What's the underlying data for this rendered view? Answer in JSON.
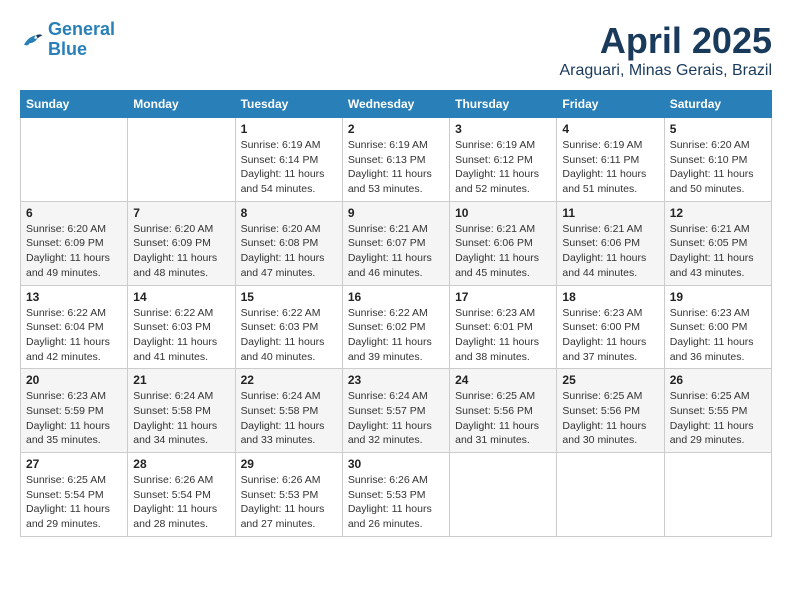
{
  "logo": {
    "line1": "General",
    "line2": "Blue"
  },
  "title": "April 2025",
  "location": "Araguari, Minas Gerais, Brazil",
  "headers": [
    "Sunday",
    "Monday",
    "Tuesday",
    "Wednesday",
    "Thursday",
    "Friday",
    "Saturday"
  ],
  "weeks": [
    [
      {
        "day": "",
        "info": ""
      },
      {
        "day": "",
        "info": ""
      },
      {
        "day": "1",
        "info": "Sunrise: 6:19 AM\nSunset: 6:14 PM\nDaylight: 11 hours and 54 minutes."
      },
      {
        "day": "2",
        "info": "Sunrise: 6:19 AM\nSunset: 6:13 PM\nDaylight: 11 hours and 53 minutes."
      },
      {
        "day": "3",
        "info": "Sunrise: 6:19 AM\nSunset: 6:12 PM\nDaylight: 11 hours and 52 minutes."
      },
      {
        "day": "4",
        "info": "Sunrise: 6:19 AM\nSunset: 6:11 PM\nDaylight: 11 hours and 51 minutes."
      },
      {
        "day": "5",
        "info": "Sunrise: 6:20 AM\nSunset: 6:10 PM\nDaylight: 11 hours and 50 minutes."
      }
    ],
    [
      {
        "day": "6",
        "info": "Sunrise: 6:20 AM\nSunset: 6:09 PM\nDaylight: 11 hours and 49 minutes."
      },
      {
        "day": "7",
        "info": "Sunrise: 6:20 AM\nSunset: 6:09 PM\nDaylight: 11 hours and 48 minutes."
      },
      {
        "day": "8",
        "info": "Sunrise: 6:20 AM\nSunset: 6:08 PM\nDaylight: 11 hours and 47 minutes."
      },
      {
        "day": "9",
        "info": "Sunrise: 6:21 AM\nSunset: 6:07 PM\nDaylight: 11 hours and 46 minutes."
      },
      {
        "day": "10",
        "info": "Sunrise: 6:21 AM\nSunset: 6:06 PM\nDaylight: 11 hours and 45 minutes."
      },
      {
        "day": "11",
        "info": "Sunrise: 6:21 AM\nSunset: 6:06 PM\nDaylight: 11 hours and 44 minutes."
      },
      {
        "day": "12",
        "info": "Sunrise: 6:21 AM\nSunset: 6:05 PM\nDaylight: 11 hours and 43 minutes."
      }
    ],
    [
      {
        "day": "13",
        "info": "Sunrise: 6:22 AM\nSunset: 6:04 PM\nDaylight: 11 hours and 42 minutes."
      },
      {
        "day": "14",
        "info": "Sunrise: 6:22 AM\nSunset: 6:03 PM\nDaylight: 11 hours and 41 minutes."
      },
      {
        "day": "15",
        "info": "Sunrise: 6:22 AM\nSunset: 6:03 PM\nDaylight: 11 hours and 40 minutes."
      },
      {
        "day": "16",
        "info": "Sunrise: 6:22 AM\nSunset: 6:02 PM\nDaylight: 11 hours and 39 minutes."
      },
      {
        "day": "17",
        "info": "Sunrise: 6:23 AM\nSunset: 6:01 PM\nDaylight: 11 hours and 38 minutes."
      },
      {
        "day": "18",
        "info": "Sunrise: 6:23 AM\nSunset: 6:00 PM\nDaylight: 11 hours and 37 minutes."
      },
      {
        "day": "19",
        "info": "Sunrise: 6:23 AM\nSunset: 6:00 PM\nDaylight: 11 hours and 36 minutes."
      }
    ],
    [
      {
        "day": "20",
        "info": "Sunrise: 6:23 AM\nSunset: 5:59 PM\nDaylight: 11 hours and 35 minutes."
      },
      {
        "day": "21",
        "info": "Sunrise: 6:24 AM\nSunset: 5:58 PM\nDaylight: 11 hours and 34 minutes."
      },
      {
        "day": "22",
        "info": "Sunrise: 6:24 AM\nSunset: 5:58 PM\nDaylight: 11 hours and 33 minutes."
      },
      {
        "day": "23",
        "info": "Sunrise: 6:24 AM\nSunset: 5:57 PM\nDaylight: 11 hours and 32 minutes."
      },
      {
        "day": "24",
        "info": "Sunrise: 6:25 AM\nSunset: 5:56 PM\nDaylight: 11 hours and 31 minutes."
      },
      {
        "day": "25",
        "info": "Sunrise: 6:25 AM\nSunset: 5:56 PM\nDaylight: 11 hours and 30 minutes."
      },
      {
        "day": "26",
        "info": "Sunrise: 6:25 AM\nSunset: 5:55 PM\nDaylight: 11 hours and 29 minutes."
      }
    ],
    [
      {
        "day": "27",
        "info": "Sunrise: 6:25 AM\nSunset: 5:54 PM\nDaylight: 11 hours and 29 minutes."
      },
      {
        "day": "28",
        "info": "Sunrise: 6:26 AM\nSunset: 5:54 PM\nDaylight: 11 hours and 28 minutes."
      },
      {
        "day": "29",
        "info": "Sunrise: 6:26 AM\nSunset: 5:53 PM\nDaylight: 11 hours and 27 minutes."
      },
      {
        "day": "30",
        "info": "Sunrise: 6:26 AM\nSunset: 5:53 PM\nDaylight: 11 hours and 26 minutes."
      },
      {
        "day": "",
        "info": ""
      },
      {
        "day": "",
        "info": ""
      },
      {
        "day": "",
        "info": ""
      }
    ]
  ]
}
